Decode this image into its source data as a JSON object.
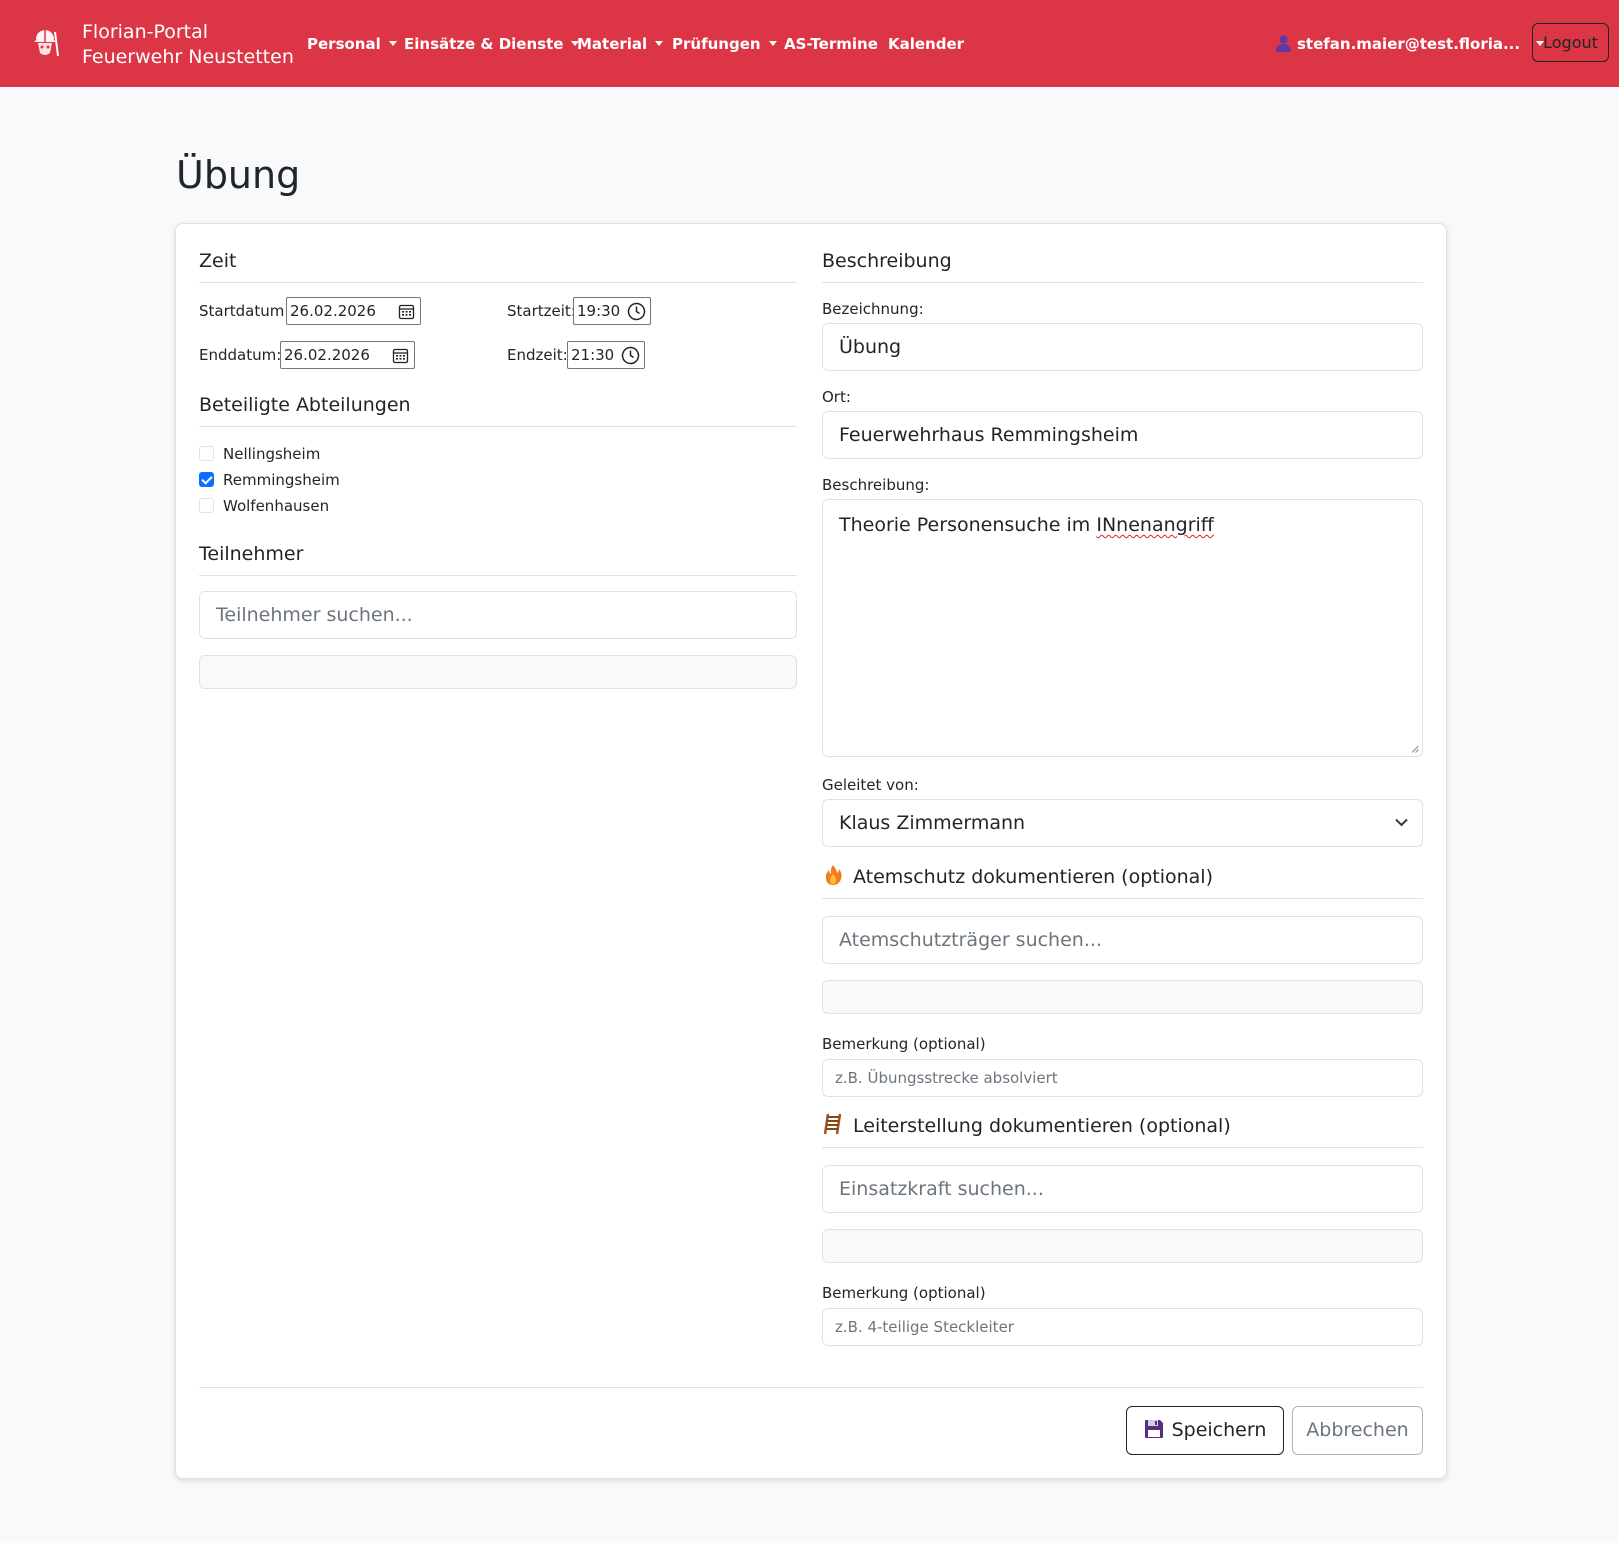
{
  "navbar": {
    "brand_line1": "Florian-Portal",
    "brand_line2": "Feuerwehr Neustetten",
    "items": [
      {
        "label": "Personal",
        "dropdown": true
      },
      {
        "label": "Einsätze & Dienste",
        "dropdown": true
      },
      {
        "label": "Material",
        "dropdown": true
      },
      {
        "label": "Prüfungen",
        "dropdown": true
      },
      {
        "label": "AS-Termine",
        "dropdown": false
      },
      {
        "label": "Kalender",
        "dropdown": false
      }
    ],
    "user": "stefan.maier@test.floria...",
    "logout": "Logout",
    "color": "#dc3545"
  },
  "page": {
    "title": "Übung"
  },
  "zeit": {
    "title": "Zeit",
    "startdatum_label": "Startdatum:",
    "startdatum": "26.02.2026",
    "startzeit_label": "Startzeit:",
    "startzeit": "19:30",
    "enddatum_label": "Enddatum:",
    "enddatum": "26.02.2026",
    "endzeit_label": "Endzeit:",
    "endzeit": "21:30"
  },
  "abteilungen": {
    "title": "Beteiligte Abteilungen",
    "items": [
      {
        "label": "Nellingsheim",
        "checked": false
      },
      {
        "label": "Remmingsheim",
        "checked": true
      },
      {
        "label": "Wolfenhausen",
        "checked": false
      }
    ]
  },
  "teilnehmer": {
    "title": "Teilnehmer",
    "search_placeholder": "Teilnehmer suchen..."
  },
  "beschreibung": {
    "title": "Beschreibung",
    "bezeichnung_label": "Bezeichnung:",
    "bezeichnung": "Übung",
    "ort_label": "Ort:",
    "ort": "Feuerwehrhaus Remmingsheim",
    "beschreibung_label": "Beschreibung:",
    "beschreibung_text_pre": "Theorie Personensuche im ",
    "beschreibung_text_misspelled": "INnenangriff",
    "geleitet_label": "Geleitet von:",
    "geleitet": "Klaus Zimmermann"
  },
  "atemschutz": {
    "title": "Atemschutz dokumentieren (optional)",
    "icon": "fire-icon",
    "search_placeholder": "Atemschutzträger suchen...",
    "bemerkung_label": "Bemerkung (optional)",
    "bemerkung_placeholder": "z.B. Übungsstrecke absolviert"
  },
  "leiter": {
    "title": "Leiterstellung dokumentieren (optional)",
    "icon": "ladder-icon",
    "search_placeholder": "Einsatzkraft suchen...",
    "bemerkung_label": "Bemerkung (optional)",
    "bemerkung_placeholder": "z.B. 4-teilige Steckleiter"
  },
  "actions": {
    "save": "Speichern",
    "cancel": "Abbrechen"
  }
}
